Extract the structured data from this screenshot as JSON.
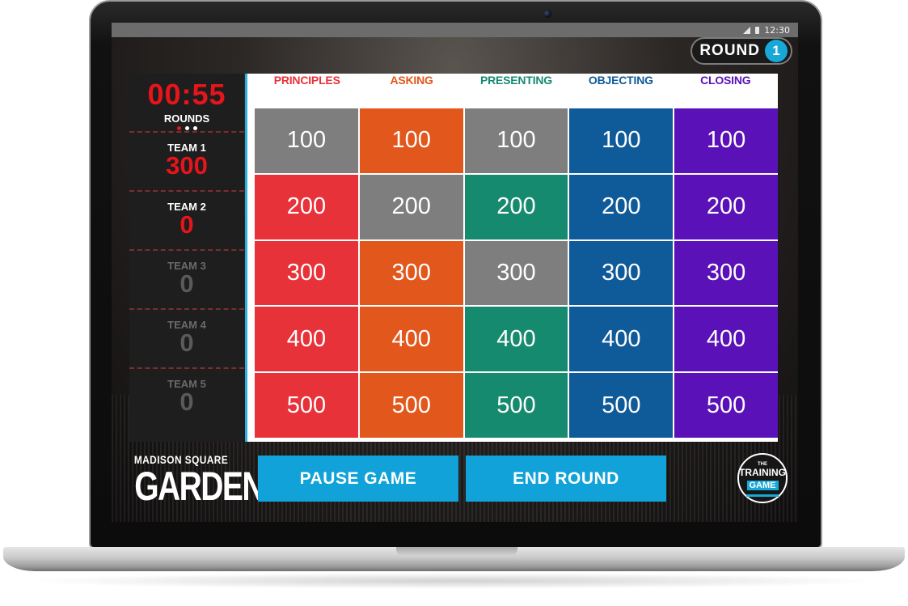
{
  "status_bar": {
    "time": "12:30",
    "icons": [
      "signal-icon",
      "battery-icon"
    ]
  },
  "round": {
    "label": "ROUND",
    "number": "1"
  },
  "timer": {
    "value": "00:55",
    "rounds_label": "ROUNDS",
    "rounds_total": 3,
    "rounds_current": 1
  },
  "teams": [
    {
      "name": "TEAM 1",
      "score": "300",
      "active": true
    },
    {
      "name": "TEAM 2",
      "score": "0",
      "active": true
    },
    {
      "name": "TEAM 3",
      "score": "0",
      "active": false
    },
    {
      "name": "TEAM 4",
      "score": "0",
      "active": false
    },
    {
      "name": "TEAM 5",
      "score": "0",
      "active": false
    }
  ],
  "board": {
    "categories": [
      {
        "label": "PRINCIPLES",
        "color": "#e8323a"
      },
      {
        "label": "ASKING",
        "color": "#e2571c"
      },
      {
        "label": "PRESENTING",
        "color": "#168a6f"
      },
      {
        "label": "OBJECTING",
        "color": "#0f5a98"
      },
      {
        "label": "CLOSING",
        "color": "#5a12b8"
      }
    ],
    "rows": [
      {
        "values": [
          "100",
          "100",
          "100",
          "100",
          "100"
        ],
        "used": [
          true,
          false,
          true,
          false,
          false
        ]
      },
      {
        "values": [
          "200",
          "200",
          "200",
          "200",
          "200"
        ],
        "used": [
          false,
          true,
          false,
          false,
          false
        ]
      },
      {
        "values": [
          "300",
          "300",
          "300",
          "300",
          "300"
        ],
        "used": [
          false,
          false,
          true,
          false,
          false
        ]
      },
      {
        "values": [
          "400",
          "400",
          "400",
          "400",
          "400"
        ],
        "used": [
          false,
          false,
          false,
          false,
          false
        ]
      },
      {
        "values": [
          "500",
          "500",
          "500",
          "500",
          "500"
        ],
        "used": [
          false,
          false,
          false,
          false,
          false
        ]
      }
    ],
    "used_color": "#7e7e7e",
    "tile_colors": [
      "#e8323a",
      "#e2571c",
      "#168a6f",
      "#0f5a98",
      "#5a12b8"
    ]
  },
  "controls": {
    "pause_label": "PAUSE GAME",
    "end_label": "END ROUND"
  },
  "branding": {
    "venue_top": "MADISON SQUARE",
    "venue_bottom": "GARDEN",
    "tg_the": "THE",
    "tg_training": "TRAINING",
    "tg_game": "GAME"
  }
}
